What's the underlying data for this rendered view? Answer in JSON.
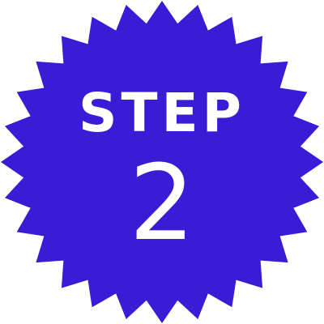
{
  "badge": {
    "label": "STEP",
    "number": "2",
    "fill_color": "#3a1bd6",
    "text_color": "#ffffff",
    "shape": "starburst",
    "spikes": 28
  }
}
